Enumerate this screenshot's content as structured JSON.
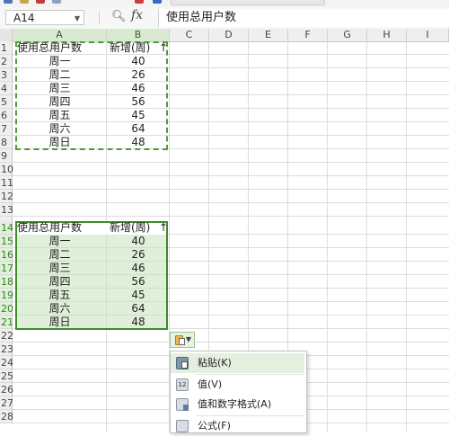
{
  "formula_bar": {
    "name_box": "A14",
    "zoom_icon": "magnifier-icon",
    "fx_label": "fx",
    "content": "使用总用户数"
  },
  "columns": [
    "A",
    "B",
    "C",
    "D",
    "E",
    "F",
    "G",
    "H",
    "I"
  ],
  "rows": [
    "1",
    "2",
    "3",
    "4",
    "5",
    "6",
    "7",
    "8",
    "9",
    "10",
    "11",
    "12",
    "13",
    "14",
    "15",
    "16",
    "17",
    "18",
    "19",
    "20",
    "21",
    "22",
    "23",
    "24",
    "25",
    "26",
    "27",
    "28"
  ],
  "table_headers": {
    "col_a": "使用总用户数",
    "col_b": "新增(周)",
    "sort_arrow": "↑"
  },
  "table_rows": [
    {
      "day": "周一",
      "value": "40"
    },
    {
      "day": "周二",
      "value": "26"
    },
    {
      "day": "周三",
      "value": "46"
    },
    {
      "day": "周四",
      "value": "56"
    },
    {
      "day": "周五",
      "value": "45"
    },
    {
      "day": "周六",
      "value": "64"
    },
    {
      "day": "周日",
      "value": "48"
    }
  ],
  "paste_options_button": {
    "icon": "clipboard-icon"
  },
  "paste_menu": {
    "items": [
      {
        "label": "粘贴(K)",
        "icon": "paste-icon"
      },
      {
        "label": "值(V)",
        "icon": "values-icon"
      },
      {
        "label": "值和数字格式(A)",
        "icon": "values-number-format-icon"
      },
      {
        "label": "公式(F)",
        "icon": "formula-icon"
      }
    ]
  },
  "colors": {
    "selection_green": "#3f8a2a",
    "paste_fill": "#c6e2ba",
    "header_bg": "#efefef"
  }
}
